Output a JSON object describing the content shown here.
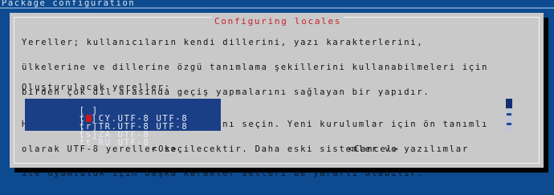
{
  "window": {
    "title": "Package configuration"
  },
  "dialog": {
    "title": "Configuring locales",
    "description": [
      "Yereller; kullanıcıların kendi dillerini, yazı karakterlerini,",
      "ülkelerine ve dillerine özgü tanımlama şekillerini kullanabilmeleri için",
      "birden çok dil arasında geçiş yapmalarını sağlayan bir yapıdır."
    ],
    "description2": [
      "Hangi yerellerin oluşturulacağını seçin. Yeni kurulumlar için ön tanımlı",
      "olarak UTF-8 yereller seçilecektir. Daha eski sistemler ve yazılımlar",
      "ile uyumluluk için başka karakter setleri de yararlı olabilir."
    ],
    "list_label": "Oluşturulacak yereller:",
    "locales": [
      {
        "checkbox": "[ ]",
        "label": "tr_CY.UTF-8 UTF-8",
        "checked": false
      },
      {
        "checkbox": "[*]",
        "label": "tr_TR.UTF-8 UTF-8",
        "checked": true
      },
      {
        "checkbox": "[ ]",
        "label": "ts_ZA UTF-8",
        "checked": false
      },
      {
        "checkbox": "[ ]",
        "label": "tt_RU UTF-8",
        "checked": false
      }
    ],
    "ok_button": "<Ok>",
    "cancel_button": "<Cancel>"
  },
  "colors": {
    "background": "#0d4a8f",
    "dialog": "#c9c9c9",
    "title": "#c91f2a",
    "list_background": "#1b3f86",
    "checked_mark": "#c81a1a"
  }
}
